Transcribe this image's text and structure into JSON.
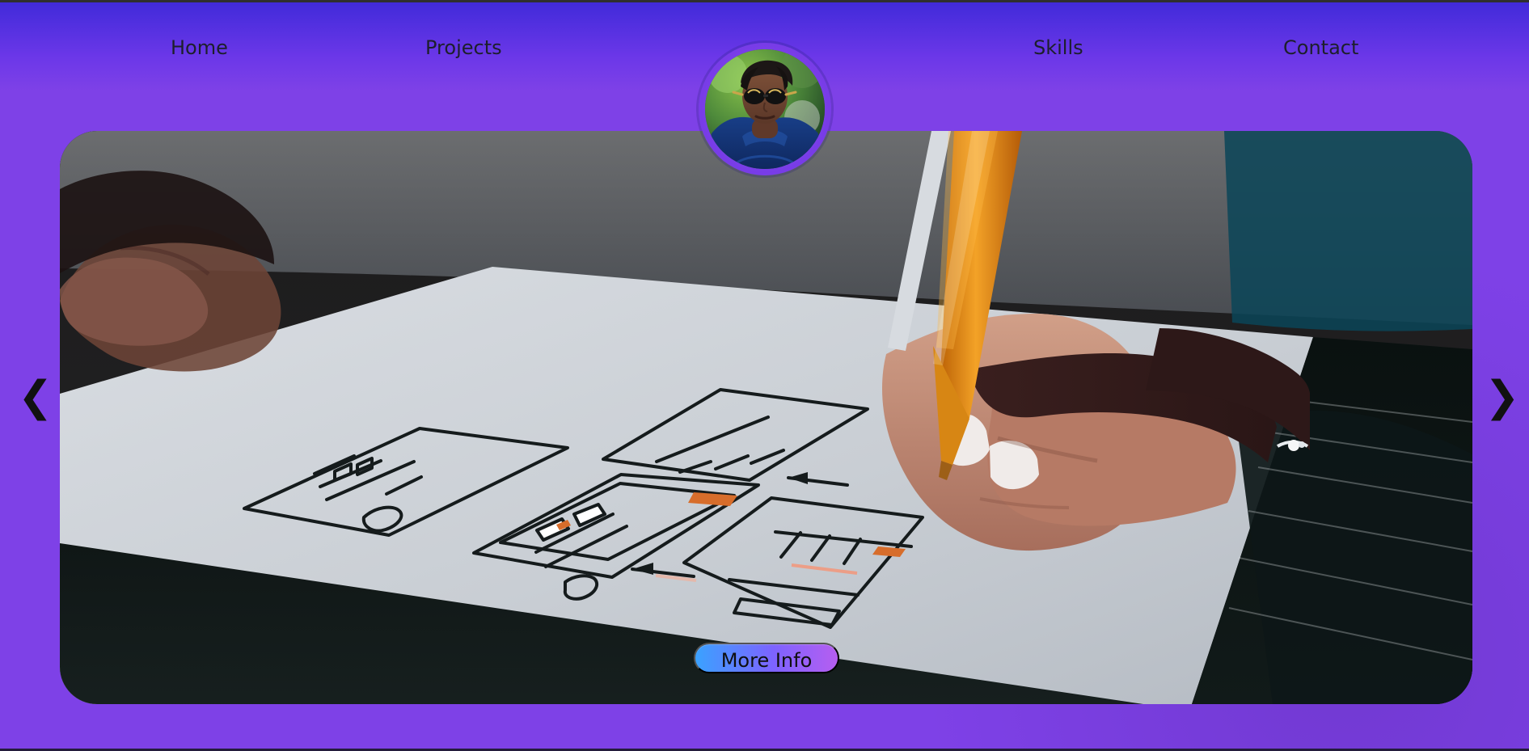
{
  "nav": {
    "home": "Home",
    "projects": "Projects",
    "skills": "Skills",
    "contact": "Contact"
  },
  "carousel": {
    "prev_symbol": "❮",
    "next_symbol": "❯",
    "button_label": "More Info"
  },
  "colors": {
    "background": "#7c3aed",
    "nav_gradient_top": "#3f2ad9",
    "button_start": "#3aa2ff",
    "button_end": "#b65ef0"
  },
  "icons": {
    "prev": "chevron-left-icon",
    "next": "chevron-right-icon"
  }
}
